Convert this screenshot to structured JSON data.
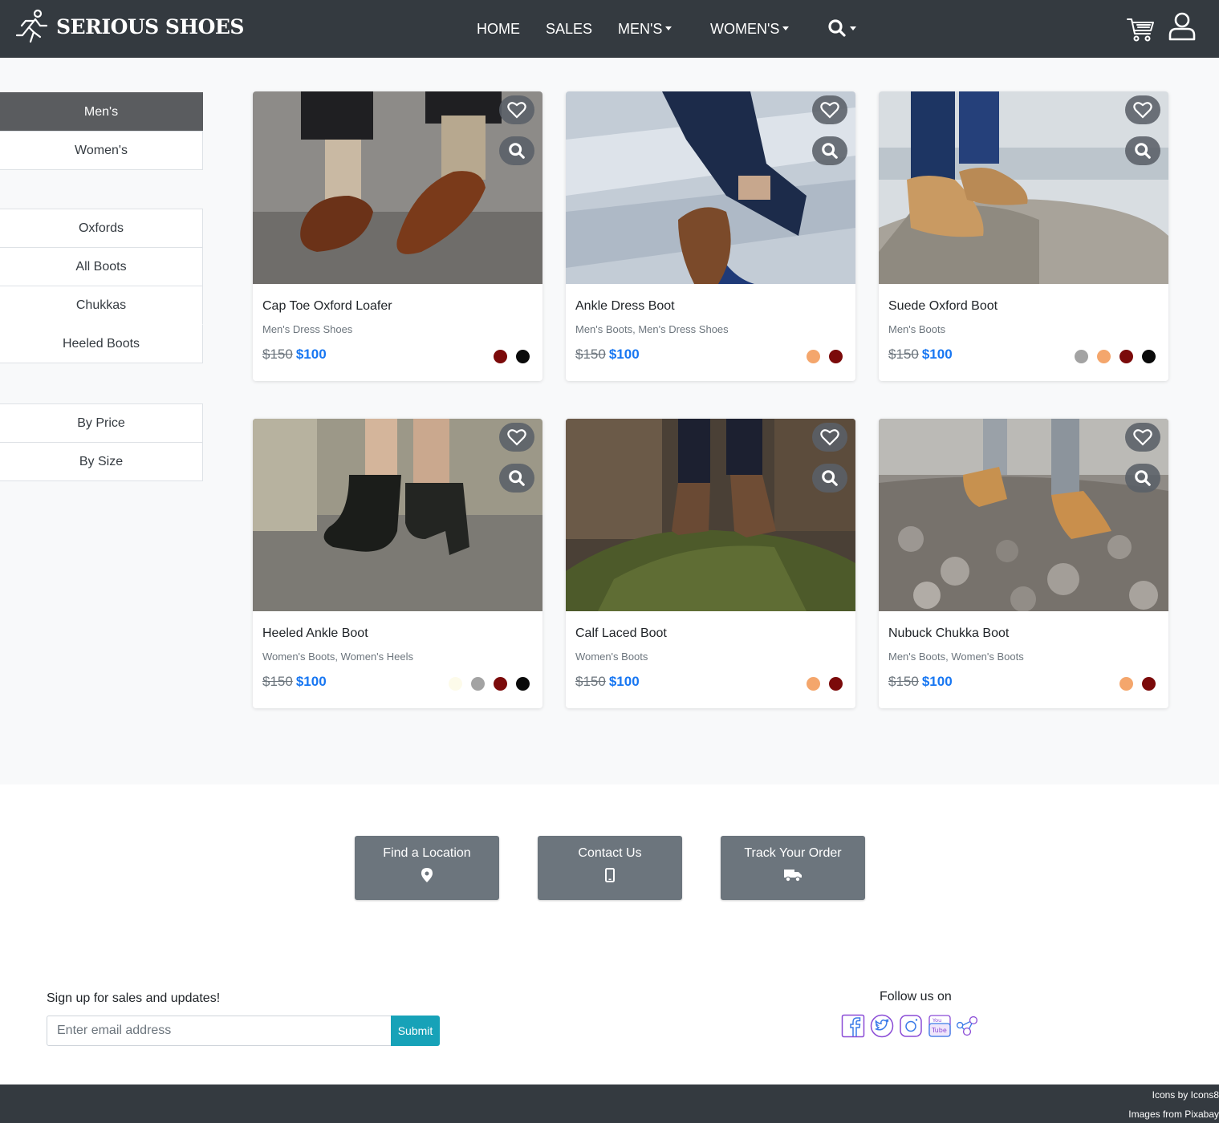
{
  "brand": {
    "name": "SERIOUS SHOES",
    "logo_icon": "running-person-icon"
  },
  "nav": {
    "home": "HOME",
    "sales": "SALES",
    "mens": "MEN'S",
    "womens": "WOMEN'S",
    "search_icon": "search-icon",
    "cart_icon": "cart-icon",
    "user_icon": "user-icon"
  },
  "sidebar": {
    "gender": [
      {
        "label": "Men's",
        "active": true
      },
      {
        "label": "Women's",
        "active": false
      }
    ],
    "styles": [
      {
        "label": "Oxfords"
      },
      {
        "label": "All Boots"
      },
      {
        "label": "Chukkas"
      },
      {
        "label": "Heeled Boots"
      }
    ],
    "sort": [
      {
        "label": "By Price"
      },
      {
        "label": "By Size"
      }
    ]
  },
  "products": [
    {
      "title": "Cap Toe Oxford Loafer",
      "category": "Men's Dress Shoes",
      "old_price": "$150",
      "price": "$100",
      "colors": [
        "#7b0a0a",
        "#0a0a0a"
      ]
    },
    {
      "title": "Ankle Dress Boot",
      "category": "Men's Boots, Men's Dress Shoes",
      "old_price": "$150",
      "price": "$100",
      "colors": [
        "#f4a66c",
        "#7b0a0a"
      ]
    },
    {
      "title": "Suede Oxford Boot",
      "category": "Men's Boots",
      "old_price": "$150",
      "price": "$100",
      "colors": [
        "#a3a3a3",
        "#f4a66c",
        "#7b0a0a",
        "#0a0a0a"
      ]
    },
    {
      "title": "Heeled Ankle Boot",
      "category": "Women's Boots, Women's Heels",
      "old_price": "$150",
      "price": "$100",
      "colors": [
        "#fdfbea",
        "#a3a3a3",
        "#7b0a0a",
        "#0a0a0a"
      ]
    },
    {
      "title": "Calf Laced Boot",
      "category": "Women's Boots",
      "old_price": "$150",
      "price": "$100",
      "colors": [
        "#f4a66c",
        "#7b0a0a"
      ]
    },
    {
      "title": "Nubuck Chukka Boot",
      "category": "Men's Boots, Women's Boots",
      "old_price": "$150",
      "price": "$100",
      "colors": [
        "#f4a66c",
        "#7b0a0a"
      ]
    }
  ],
  "info_buttons": {
    "location": {
      "label": "Find a Location",
      "icon": "map-marker-icon"
    },
    "contact": {
      "label": "Contact Us",
      "icon": "mobile-phone-icon"
    },
    "track": {
      "label": "Track Your Order",
      "icon": "delivery-truck-icon"
    }
  },
  "signup": {
    "label": "Sign up for sales and updates!",
    "placeholder": "Enter email address",
    "submit": "Submit"
  },
  "follow": {
    "label": "Follow us on",
    "icons": [
      "facebook-icon",
      "twitter-icon",
      "instagram-icon",
      "youtube-icon",
      "share-icon"
    ]
  },
  "footer": {
    "credit_icons": "Icons by Icons8",
    "credit_images": "Images from Pixabay"
  },
  "colors": {
    "navbar": "#343a40",
    "accent_price": "#1877f2",
    "info_button": "#6c757d",
    "submit": "#17a2b8",
    "social": "#8a4bd6"
  }
}
